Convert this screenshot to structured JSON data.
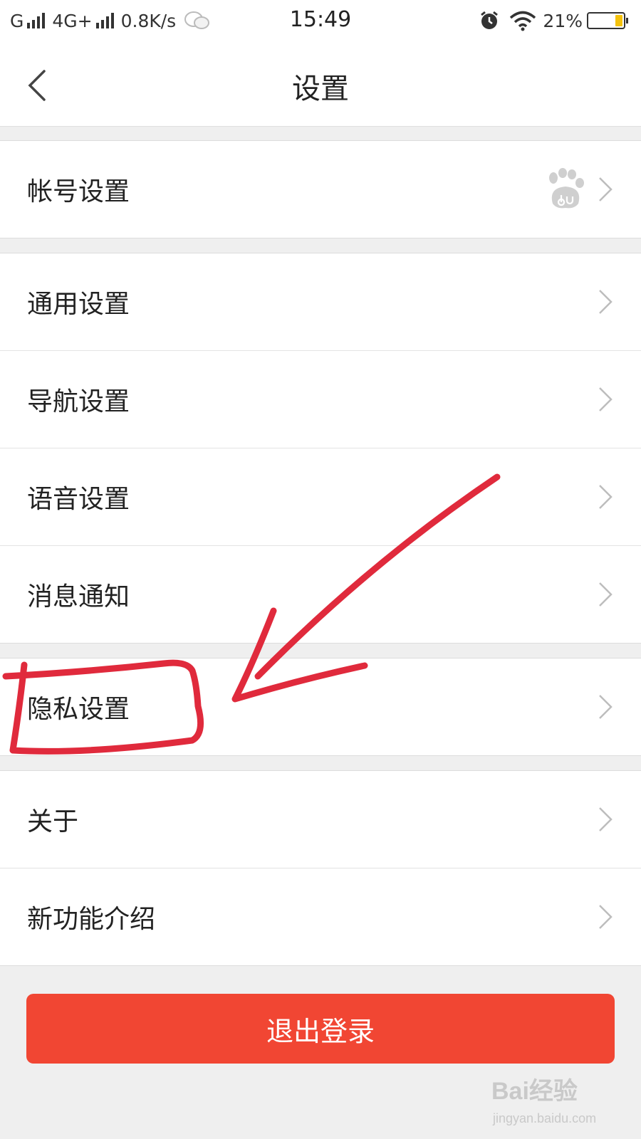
{
  "status_bar": {
    "carrier1": "G",
    "carrier2": "4G+",
    "net_speed": "0.8K/s",
    "time": "15:49",
    "battery": "21%",
    "battery_level": 0.21,
    "icons": [
      "signal-icon",
      "wechat-icon",
      "alarm-icon",
      "wifi-icon",
      "battery-icon"
    ]
  },
  "nav": {
    "title": "设置",
    "back_icon": "back-arrow-icon"
  },
  "groups": [
    {
      "items": [
        {
          "label": "帐号设置",
          "badge_icon": "baidu-paw-icon"
        }
      ]
    },
    {
      "items": [
        {
          "label": "通用设置"
        },
        {
          "label": "导航设置"
        },
        {
          "label": "语音设置"
        },
        {
          "label": "消息通知"
        }
      ]
    },
    {
      "items": [
        {
          "label": "隐私设置"
        }
      ]
    },
    {
      "items": [
        {
          "label": "关于"
        },
        {
          "label": "新功能介绍"
        }
      ]
    }
  ],
  "logout": {
    "label": "退出登录"
  },
  "colors": {
    "accent": "#f14633",
    "annotation": "#e02a3c",
    "background": "#efefef"
  },
  "watermark": {
    "text": "Bai经验",
    "url": "jingyan.baidu.com"
  }
}
